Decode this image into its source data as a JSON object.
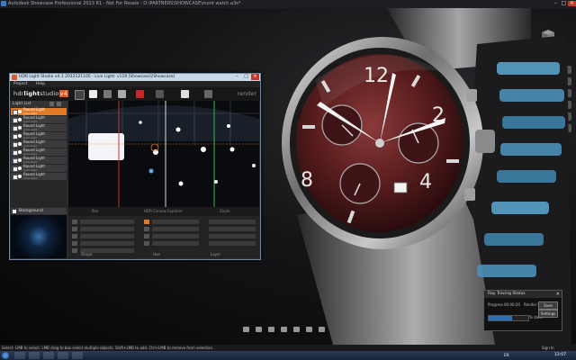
{
  "window": {
    "title": "Autodesk Showcase Professional 2013 R1 - Not For Resale - D:\\PARTNERS\\SHOWCASE\\mont watch.a3s*",
    "minimize": "–",
    "maximize": "□",
    "close": "✕"
  },
  "hls": {
    "title": "HDR Light Studio v4.1 2012121105 - Live Light: v119 [Showcase]/Showcase]",
    "minimize": "–",
    "maximize": "□",
    "close": "✕",
    "menu": [
      "Project",
      "Help"
    ],
    "logo_part1": "hdr",
    "logo_part2": "light",
    "logo_part3": "studio",
    "logo_version": "v4",
    "render_label": "render",
    "light_list_title": "Light List",
    "lights": [
      {
        "name": "Round Light",
        "sub": "Area Light",
        "selected": true
      },
      {
        "name": "Round Light",
        "sub": "Area Light",
        "selected": false
      },
      {
        "name": "Round Light",
        "sub": "Area Light",
        "selected": false
      },
      {
        "name": "Round Light",
        "sub": "Area Light",
        "selected": false
      },
      {
        "name": "Round Light",
        "sub": "Area Light",
        "selected": false
      },
      {
        "name": "Round Light",
        "sub": "Area Light",
        "selected": false
      },
      {
        "name": "Round Light",
        "sub": "Area Light",
        "selected": false
      },
      {
        "name": "Round Light",
        "sub": "Area Light",
        "selected": false
      },
      {
        "name": "Round Light",
        "sub": "Area Light",
        "selected": false
      }
    ],
    "background_label": "Background",
    "canvas_bar": [
      "Pan",
      "HDR Canvas Explorer",
      "Zoom"
    ],
    "props_bottom": [
      "Shape",
      "Hue",
      "Layer"
    ]
  },
  "rts": {
    "title": "Ray Tracing Status",
    "close": "✕",
    "progress_label": "Progress",
    "progress_value": "00:00:20",
    "render_level_label": "Render Level",
    "render_level_value": "1",
    "percent": "% done",
    "progress_fraction": 0.6,
    "save_button": "Save",
    "settings_button": "Settings"
  },
  "status": {
    "message": "Select: LMB to select. LMB drag to box select multiple objects. Shift+LMB to add. Ctrl+LMB to remove from selection.",
    "sign_in": "Sign In"
  },
  "taskbar": {
    "tray": "EN",
    "clock": "12:07"
  },
  "colors": {
    "accent": "#e07a26",
    "hls_border": "#6a8aa8",
    "progress_fill": "#2d6fb5"
  }
}
